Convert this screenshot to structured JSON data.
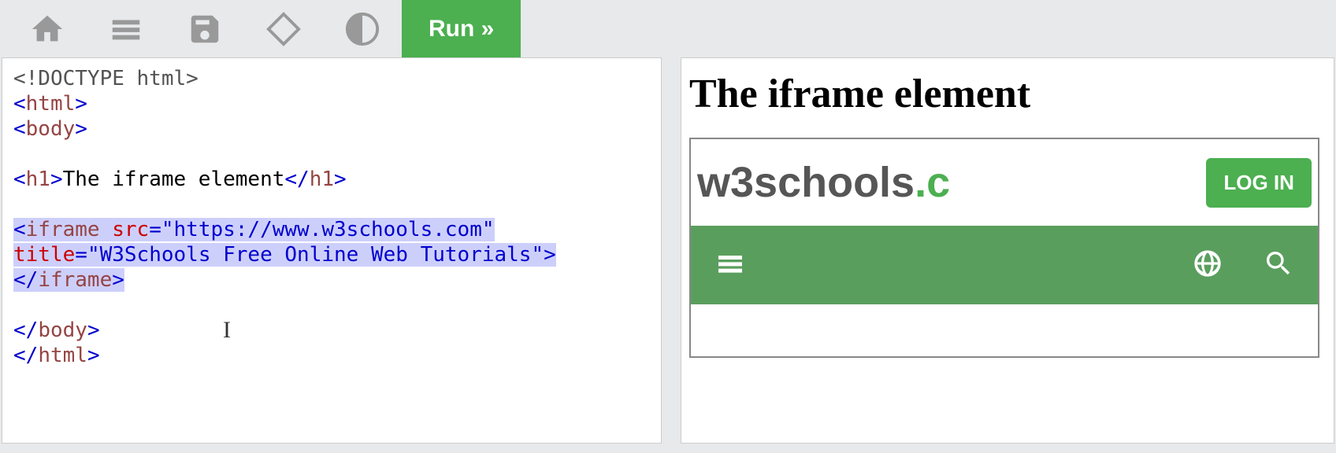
{
  "toolbar": {
    "run_label": "Run »"
  },
  "code": {
    "l1_doctype": "<!DOCTYPE html>",
    "l2_o": "<",
    "l2_tag": "html",
    "l2_c": ">",
    "l3_o": "<",
    "l3_tag": "body",
    "l3_c": ">",
    "l4_o": "<",
    "l4_tag": "h1",
    "l4_c": ">",
    "l4_txt": "The iframe element",
    "l4_oc": "</",
    "l4_cc": ">",
    "l5_o": "<",
    "l5_tag": "iframe",
    "l5_a1": " src",
    "l5_eq1": "=",
    "l5_v1": "\"https://www.w3schools.com\"",
    "l6_a2": "title",
    "l6_eq2": "=",
    "l6_v2": "\"W3Schools Free Online Web Tutorials\"",
    "l6_c": ">",
    "l7_oc": "</",
    "l7_tag": "iframe",
    "l7_c": ">",
    "l8_oc": "</",
    "l8_tag": "body",
    "l8_c": ">",
    "l9_oc": "</",
    "l9_tag": "html",
    "l9_c": ">"
  },
  "output": {
    "heading": "The iframe element",
    "logo_text_a": "w3schools",
    "logo_text_b": ".c",
    "login_label": "LOG IN"
  }
}
